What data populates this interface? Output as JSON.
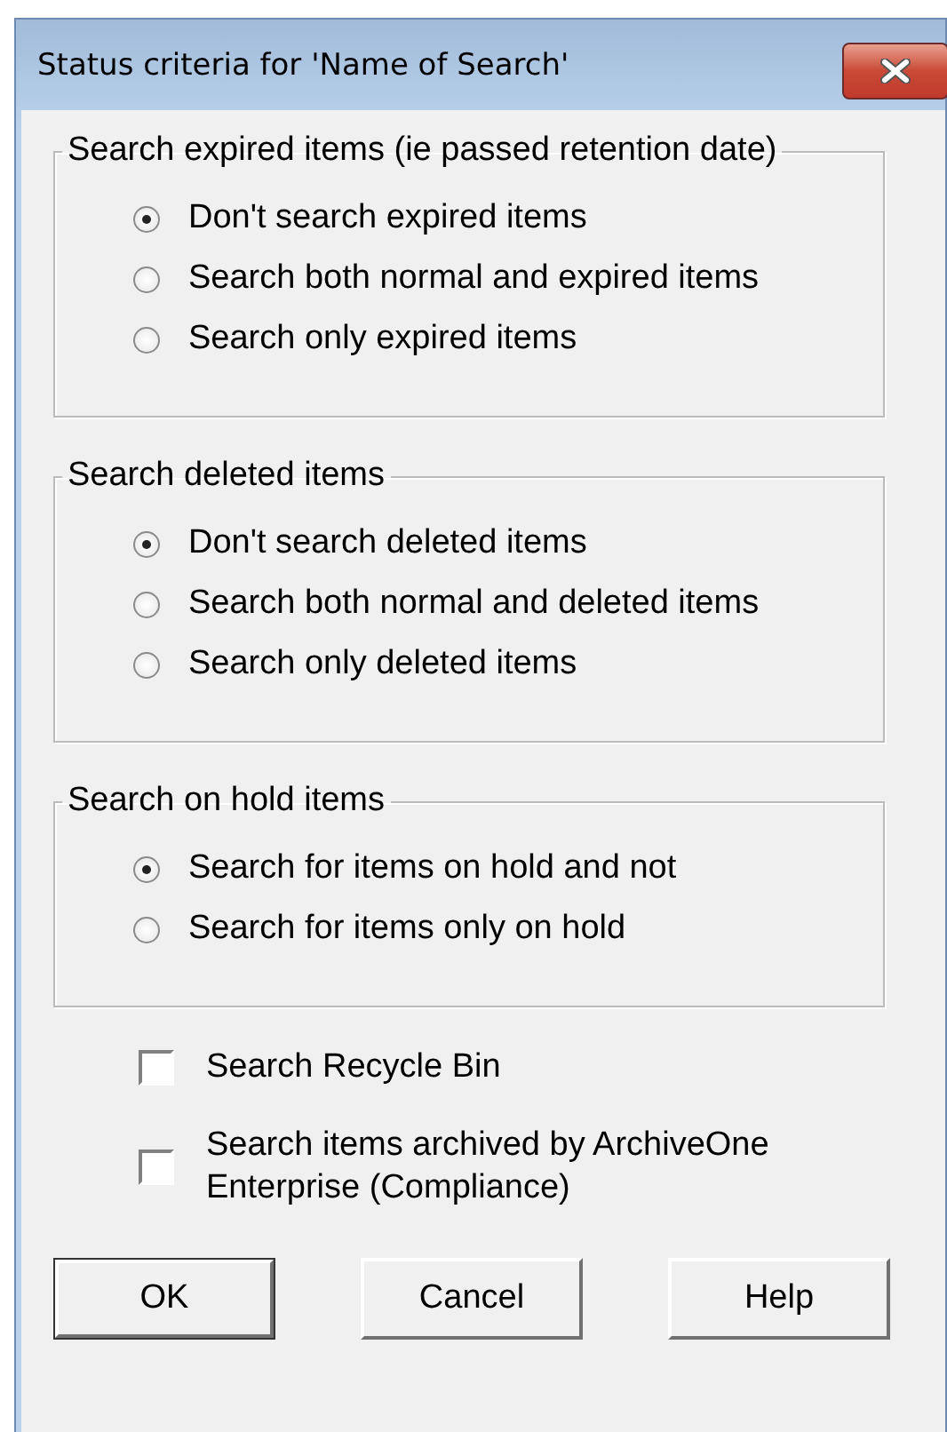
{
  "window": {
    "title": "Status criteria for 'Name of Search'"
  },
  "groups": [
    {
      "legend": "Search expired items (ie passed retention date)",
      "options": [
        {
          "label": "Don't search expired items",
          "selected": true
        },
        {
          "label": "Search both normal and expired items",
          "selected": false
        },
        {
          "label": "Search only expired items",
          "selected": false
        }
      ]
    },
    {
      "legend": "Search deleted items",
      "options": [
        {
          "label": "Don't search deleted items",
          "selected": true
        },
        {
          "label": "Search both normal and deleted items",
          "selected": false
        },
        {
          "label": "Search only deleted items",
          "selected": false
        }
      ]
    },
    {
      "legend": "Search on hold items",
      "options": [
        {
          "label": "Search for items on hold and not",
          "selected": true
        },
        {
          "label": "Search for items only on hold",
          "selected": false
        }
      ]
    }
  ],
  "checkboxes": [
    {
      "label": "Search Recycle Bin",
      "checked": false
    },
    {
      "label": "Search items archived by ArchiveOne Enterprise (Compliance)",
      "checked": false
    }
  ],
  "buttons": [
    {
      "label": "OK",
      "default": true
    },
    {
      "label": "Cancel",
      "default": false
    },
    {
      "label": "Help",
      "default": false
    }
  ]
}
